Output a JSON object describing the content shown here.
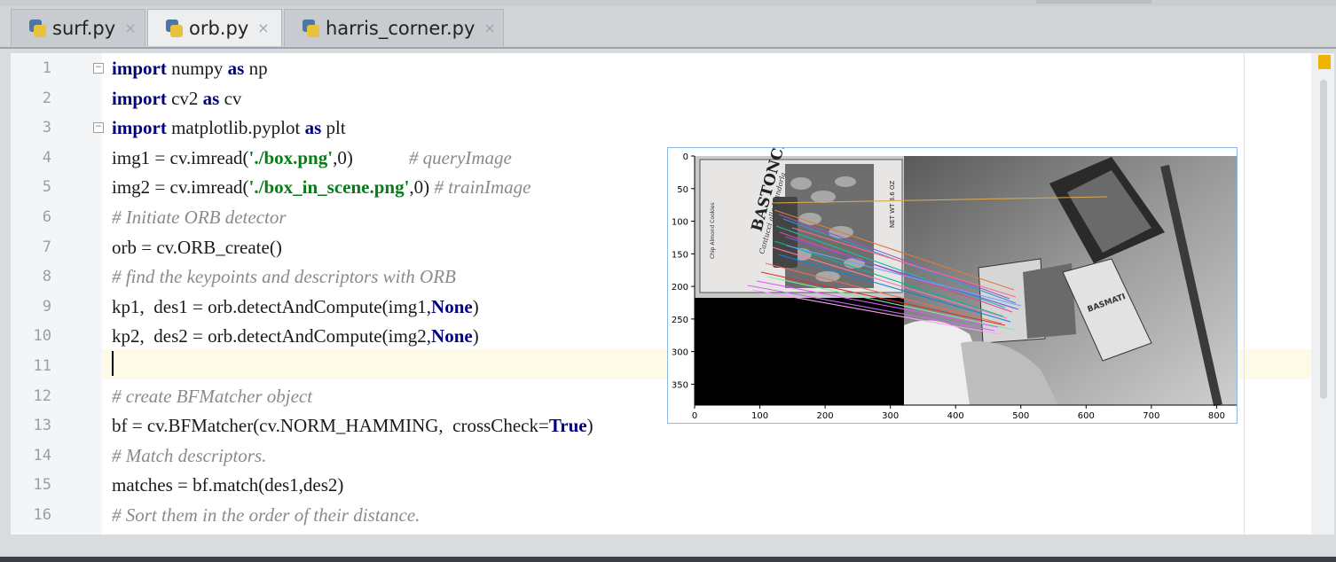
{
  "tabs": [
    {
      "label": "surf.py",
      "close": "×",
      "active": false
    },
    {
      "label": "orb.py",
      "close": "×",
      "active": true
    },
    {
      "label": "harris_corner.py",
      "close": "×",
      "active": false
    }
  ],
  "lines": [
    {
      "num": "1",
      "tokens": [
        {
          "t": "import",
          "c": "kw"
        },
        {
          "t": " numpy "
        },
        {
          "t": "as",
          "c": "kw"
        },
        {
          "t": " np"
        }
      ]
    },
    {
      "num": "2",
      "tokens": [
        {
          "t": "import",
          "c": "kw"
        },
        {
          "t": " cv2 "
        },
        {
          "t": "as",
          "c": "kw"
        },
        {
          "t": " cv"
        }
      ]
    },
    {
      "num": "3",
      "tokens": [
        {
          "t": "import",
          "c": "kw"
        },
        {
          "t": " matplotlib.pyplot "
        },
        {
          "t": "as",
          "c": "kw"
        },
        {
          "t": " plt"
        }
      ]
    },
    {
      "num": "4",
      "tokens": [
        {
          "t": "img1 = cv.imread("
        },
        {
          "t": "'./box.png'",
          "c": "str"
        },
        {
          "t": ",0)"
        },
        {
          "t": "            # queryImage",
          "c": "cm"
        }
      ]
    },
    {
      "num": "5",
      "tokens": [
        {
          "t": "img2 = cv.imread("
        },
        {
          "t": "'./box_in_scene.png'",
          "c": "str"
        },
        {
          "t": ",0) "
        },
        {
          "t": "# trainImage",
          "c": "cm"
        }
      ]
    },
    {
      "num": "6",
      "tokens": [
        {
          "t": "# Initiate ORB detector",
          "c": "cm"
        }
      ]
    },
    {
      "num": "7",
      "tokens": [
        {
          "t": "orb = cv.ORB_create()"
        }
      ]
    },
    {
      "num": "8",
      "tokens": [
        {
          "t": "# find the keypoints and descriptors with ORB",
          "c": "cm"
        }
      ]
    },
    {
      "num": "9",
      "tokens": [
        {
          "t": "kp1,  des1 = orb.detectAndCompute(img1,"
        },
        {
          "t": "None",
          "c": "kw"
        },
        {
          "t": ")"
        }
      ]
    },
    {
      "num": "10",
      "tokens": [
        {
          "t": "kp2,  des2 = orb.detectAndCompute(img2,"
        },
        {
          "t": "None",
          "c": "kw"
        },
        {
          "t": ")"
        }
      ]
    },
    {
      "num": "11",
      "tokens": []
    },
    {
      "num": "12",
      "tokens": [
        {
          "t": "# create BFMatcher object",
          "c": "cm"
        }
      ]
    },
    {
      "num": "13",
      "tokens": [
        {
          "t": "bf = cv.BFMatcher(cv.NORM_HAMMING,  crossCheck="
        },
        {
          "t": "True",
          "c": "kw"
        },
        {
          "t": ")"
        }
      ]
    },
    {
      "num": "14",
      "tokens": [
        {
          "t": "# Match descriptors.",
          "c": "cm"
        }
      ]
    },
    {
      "num": "15",
      "tokens": [
        {
          "t": "matches = bf.match(des1,des2)"
        }
      ]
    },
    {
      "num": "16",
      "tokens": [
        {
          "t": "# Sort them in the order of their distance.",
          "c": "cm"
        }
      ]
    }
  ],
  "plot": {
    "xticks": [
      "0",
      "100",
      "200",
      "300",
      "400",
      "500",
      "600",
      "700",
      "800"
    ],
    "yticks": [
      "0",
      "50",
      "100",
      "150",
      "200",
      "250",
      "300",
      "350"
    ],
    "left_image_text": {
      "brand": "BASTONCINI",
      "sub": "Cantucci alla Mandorla",
      "side": "NET WT 8.6 OZ",
      "vertical": "Chip Almond Cookies"
    },
    "right_image_text": {
      "box": "BASMATI"
    }
  },
  "colors": {
    "keyword": "#00007f",
    "string": "#067d17",
    "comment": "#8a8a8a",
    "accent": "#f0b400"
  }
}
